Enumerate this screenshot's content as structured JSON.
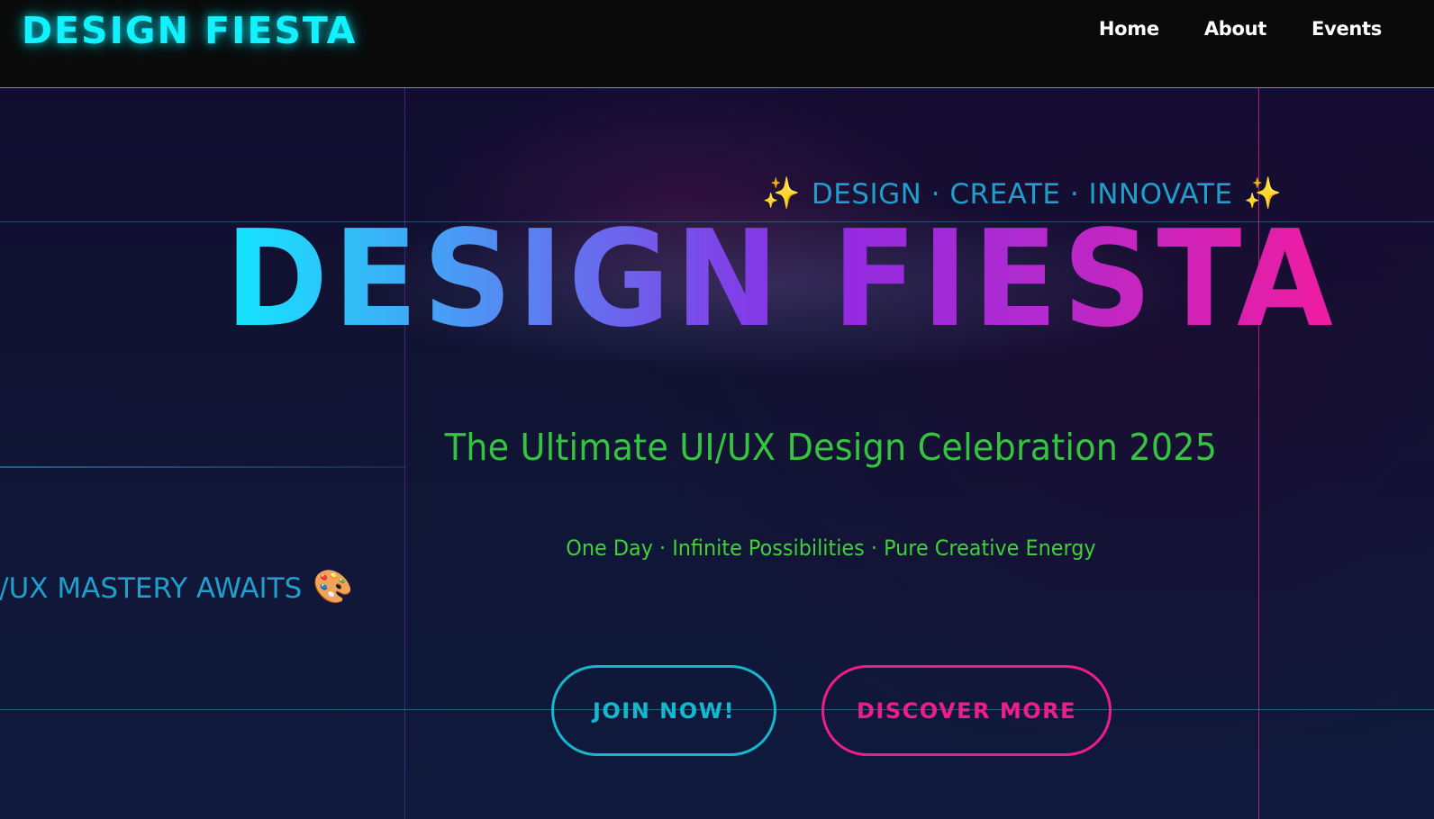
{
  "header": {
    "logo": "DESIGN FIESTA",
    "nav": [
      {
        "label": "Home"
      },
      {
        "label": "About"
      },
      {
        "label": "Events"
      }
    ]
  },
  "hero": {
    "tagline": "DESIGN · CREATE · INNOVATE",
    "sparkle": "✨",
    "title": "DESIGN FIESTA",
    "subtitle": "The Ultimate UI/UX Design Celebration 2025",
    "subline": "One Day · Infinite Possibilities · Pure Creative Energy",
    "marquee_text": "I/UX MASTERY AWAITS",
    "palette_icon": "🎨",
    "buttons": {
      "join": "JOIN NOW!",
      "discover": "DISCOVER MORE"
    }
  },
  "colors": {
    "accent_cyan": "#13f1ff",
    "accent_magenta": "#ee1c8f",
    "text_green": "#35c43f",
    "tagline_blue": "#1f9fc9"
  }
}
